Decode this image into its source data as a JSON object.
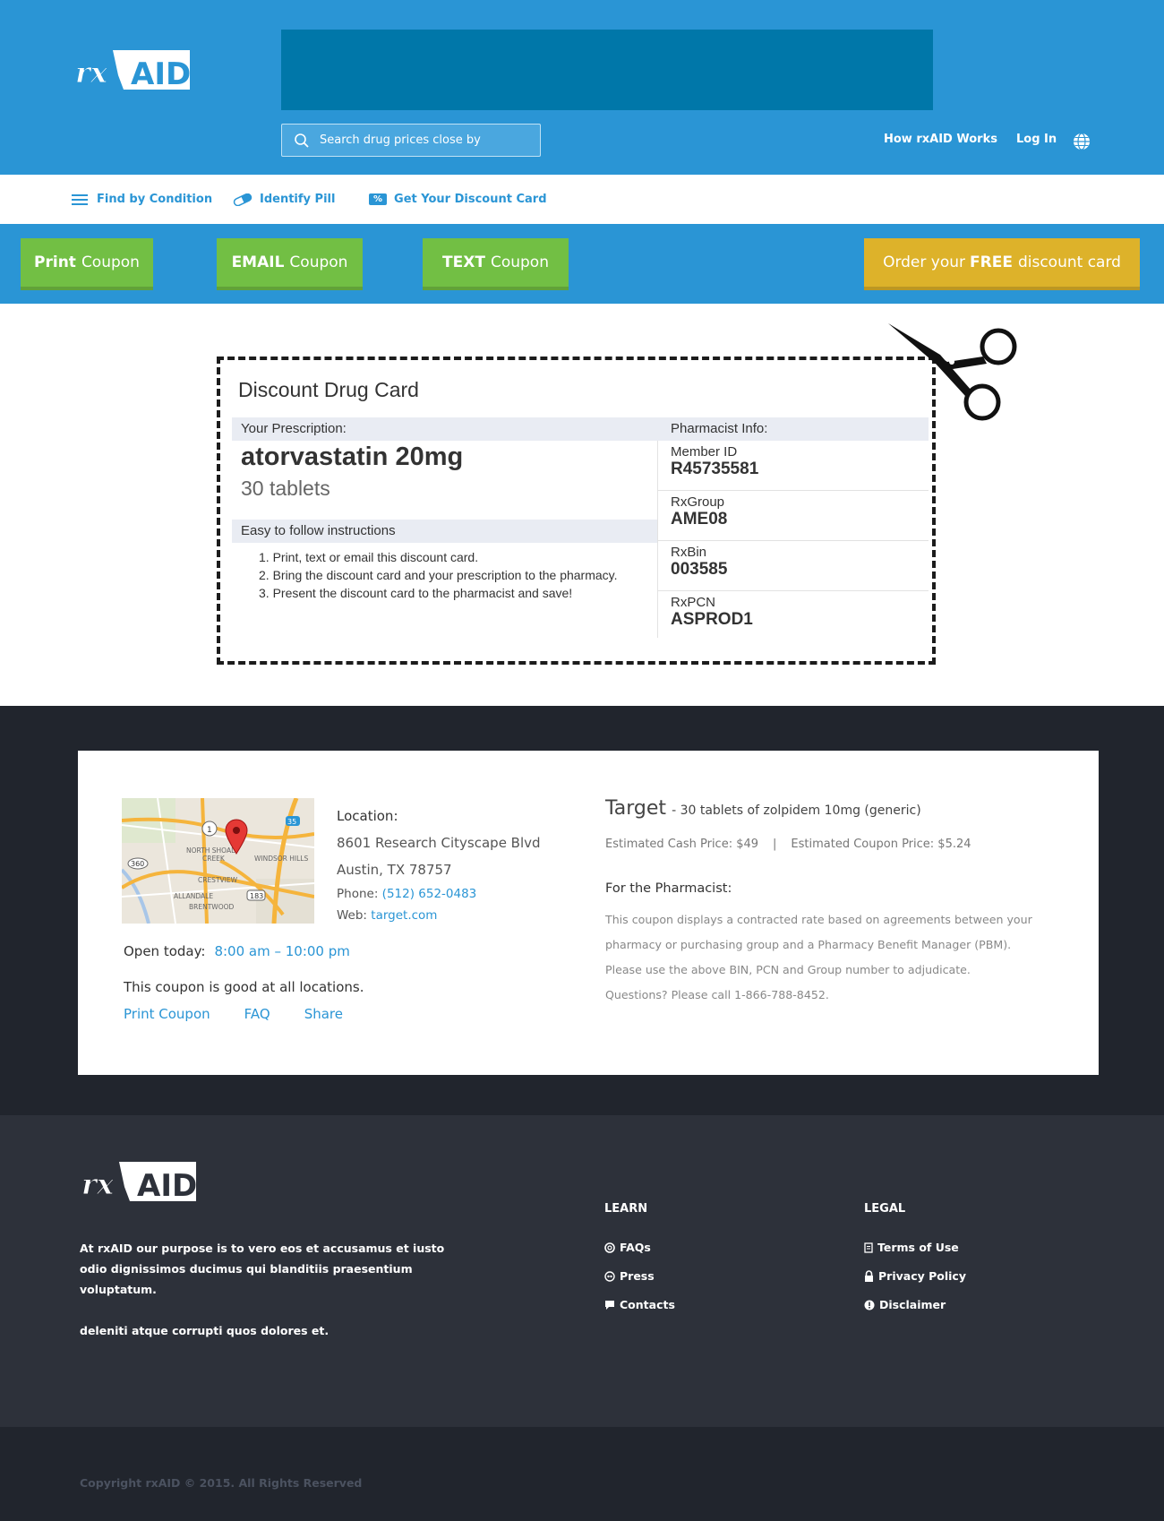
{
  "header": {
    "logo_text": "rxAID",
    "search_placeholder": "Search drug prices close by",
    "nav_how": "How rxAID Works",
    "nav_login": "Log In"
  },
  "subnav": {
    "find_by_condition": "Find by Condition",
    "identify_pill": "Identify Pill",
    "discount_card_badge": "%",
    "get_discount_card": "Get Your Discount Card"
  },
  "actions": {
    "print_bold": "Print",
    "print_rest": "Coupon",
    "email_bold": "EMAIL",
    "email_rest": "Coupon",
    "text_bold": "TEXT",
    "text_rest": "Coupon",
    "order_pre": "Order your",
    "order_bold": "FREE",
    "order_post": "discount card"
  },
  "card": {
    "title": "Discount Drug Card",
    "rx_header": "Your Prescription:",
    "drug": "atorvastatin 20mg",
    "quantity": "30 tablets",
    "instructions_header": "Easy to follow instructions",
    "instructions": [
      "1.  Print, text or email this discount card.",
      "2.  Bring the discount card and your prescription to the pharmacy.",
      "3.  Present the discount card to the pharmacist and save!"
    ],
    "pharmacist_header": "Pharmacist Info:",
    "pharmacist_fields": [
      {
        "label": "Member ID",
        "value": "R45735581"
      },
      {
        "label": "RxGroup",
        "value": "AME08"
      },
      {
        "label": "RxBin",
        "value": "003585"
      },
      {
        "label": "RxPCN",
        "value": "ASPROD1"
      }
    ]
  },
  "pharmacy": {
    "location_label": "Location:",
    "address1": "8601 Research Cityscape Blvd",
    "address2": "Austin, TX 78757",
    "phone_label": "Phone:",
    "phone": "(512) 652-0483",
    "web_label": "Web:",
    "web": "target.com",
    "open_label": "Open today:",
    "open_hours": "8:00 am – 10:00 pm",
    "good_at": "This coupon is good at all locations.",
    "links": [
      "Print Coupon",
      "FAQ",
      "Share"
    ],
    "store_name": "Target",
    "store_detail": "- 30 tablets of zolpidem 10mg (generic)",
    "cash_price": "Estimated Cash Price: $49",
    "price_sep": "|",
    "coupon_price": "Estimated Coupon Price: $5.24",
    "for_pharmacist": "For the Pharmacist:",
    "pharmacist_note": "This coupon displays a contracted rate based on agreements between your pharmacy or purchasing group and a Pharmacy Benefit Manager (PBM). Please use the above BIN, PCN and Group number to adjudicate. Questions? Please call 1-866-788-8452.",
    "map_labels": {
      "north_shoal": "NORTH SHOAL",
      "creek": "CREEK",
      "windsor": "WINDSOR HILLS",
      "crestview": "CRESTVIEW",
      "allandale": "ALLANDALE",
      "brentwood": "BRENTWOOD",
      "r1": "1",
      "r35": "35",
      "r360": "360",
      "r183": "183"
    }
  },
  "footer": {
    "about1": "At rxAID our purpose is to vero eos et accusamus et iusto odio dignissimos ducimus qui blanditiis praesentium voluptatum.",
    "about2": "deleniti atque corrupti quos dolores et.",
    "learn_title": "LEARN",
    "learn_links": [
      "FAQs",
      "Press",
      "Contacts"
    ],
    "legal_title": "LEGAL",
    "legal_links": [
      "Terms of Use",
      "Privacy Policy",
      "Disclaimer"
    ],
    "copyright": "Copyright rxAID © 2015. All Rights Reserved"
  },
  "colors": {
    "brand_blue": "#2a95d5",
    "green": "#72bf44",
    "yellow": "#ddb22a",
    "dark": "#21252d"
  }
}
